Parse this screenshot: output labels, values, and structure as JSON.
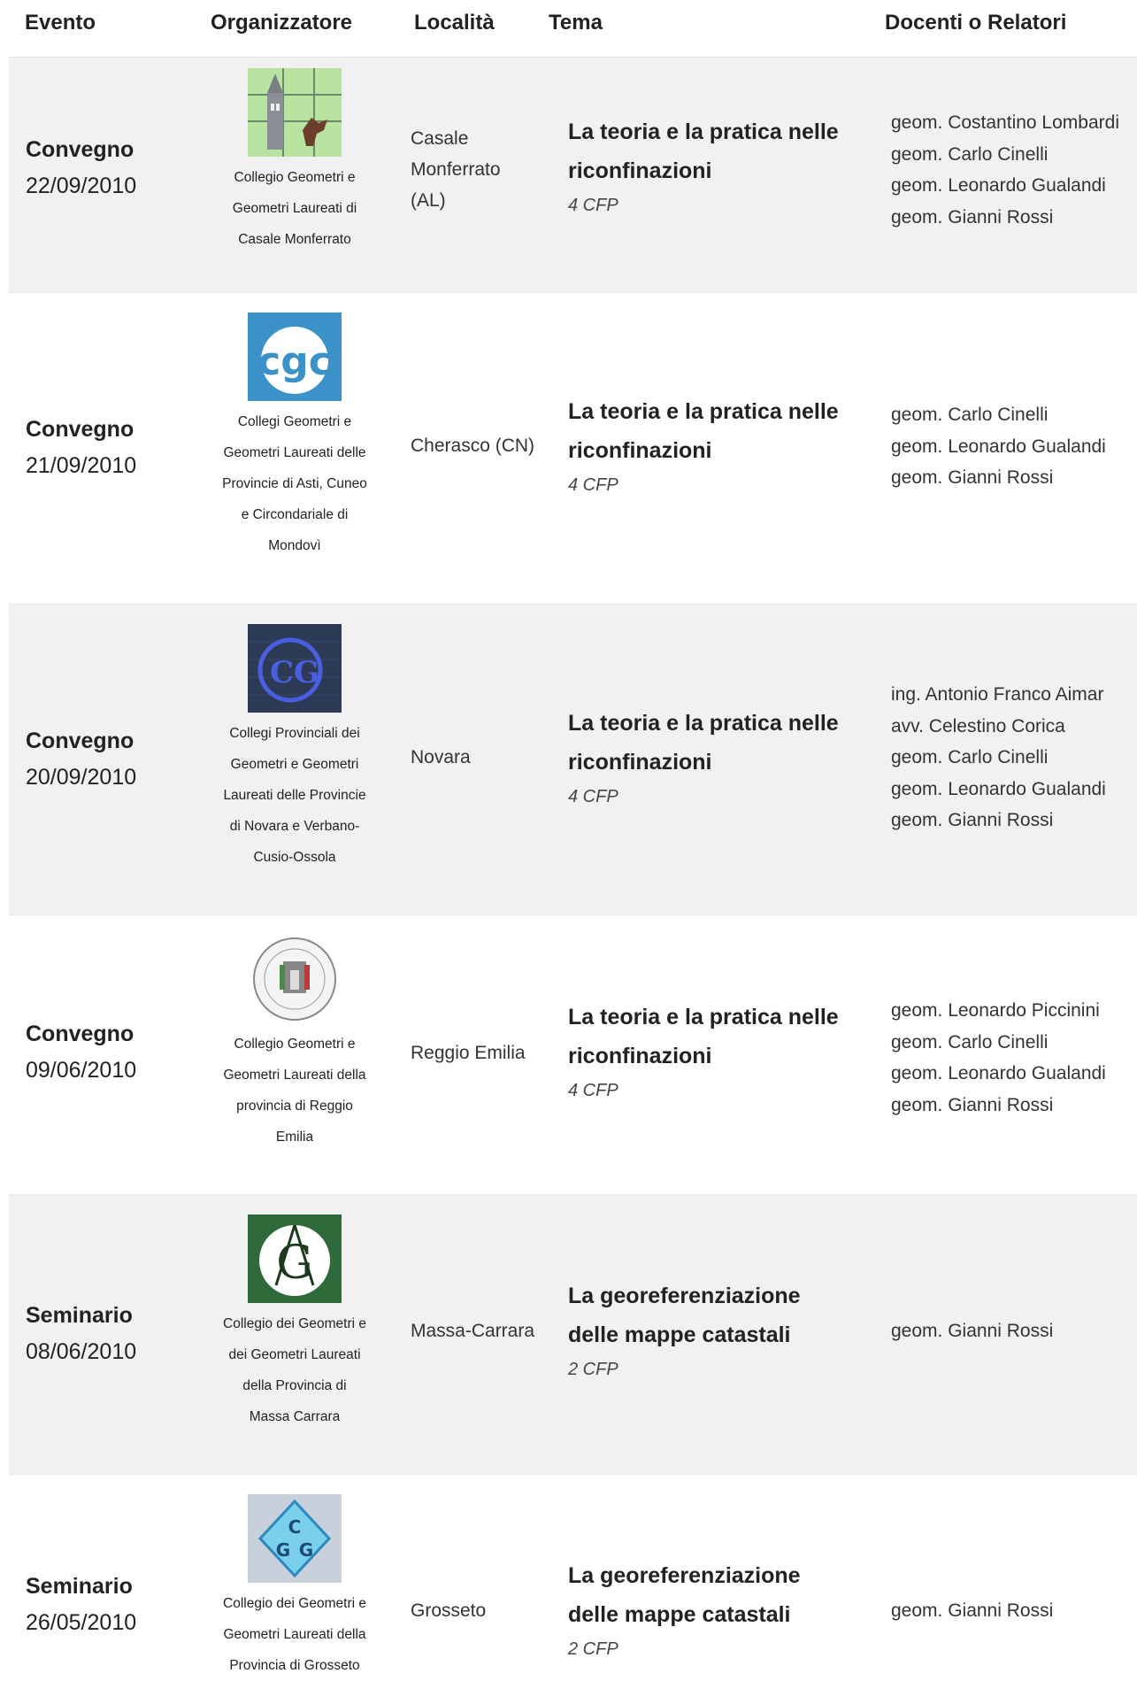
{
  "headers": {
    "evento": "Evento",
    "organizzatore": "Organizzatore",
    "localita": "Località",
    "tema": "Tema",
    "docenti": "Docenti o Relatori"
  },
  "rows": [
    {
      "type": "Convegno",
      "date": "22/09/2010",
      "logo": "casale-tower-logo",
      "org": [
        "Collegio Geometri e",
        "Geometri Laureati di",
        "Casale Monferrato"
      ],
      "loc": [
        "Casale",
        "Monferrato",
        "(AL)"
      ],
      "tema": [
        "La teoria e la pratica nelle",
        "riconfinazioni"
      ],
      "cfp": "4 CFP",
      "speakers": [
        "geom. Costantino Lombardi",
        "geom. Carlo Cinelli",
        "geom. Leonardo Gualandi",
        "geom. Gianni Rossi"
      ]
    },
    {
      "type": "Convegno",
      "date": "21/09/2010",
      "logo": "cgc-blue-logo",
      "org": [
        "Collegi Geometri e",
        "Geometri Laureati delle",
        "Provincie di Asti, Cuneo",
        "e Circondariale di",
        "Mondovì"
      ],
      "loc": [
        "Cherasco (CN)"
      ],
      "tema": [
        "La teoria e la pratica nelle",
        "riconfinazioni"
      ],
      "cfp": "4 CFP",
      "speakers": [
        "geom. Carlo Cinelli",
        "geom. Leonardo Gualandi",
        "geom. Gianni Rossi"
      ]
    },
    {
      "type": "Convegno",
      "date": "20/09/2010",
      "logo": "cg-novara-logo",
      "org": [
        "Collegi Provinciali dei",
        "Geometri e Geometri",
        "Laureati delle Provincie",
        "di Novara e Verbano-",
        "Cusio-Ossola"
      ],
      "loc": [
        "Novara"
      ],
      "tema": [
        "La teoria e la pratica nelle",
        "riconfinazioni"
      ],
      "cfp": "4 CFP",
      "speakers": [
        "ing. Antonio Franco Aimar",
        "avv. Celestino Corica",
        "geom. Carlo Cinelli",
        "geom. Leonardo Gualandi",
        "geom. Gianni Rossi"
      ]
    },
    {
      "type": "Convegno",
      "date": "09/06/2010",
      "logo": "reggio-seal-logo",
      "org": [
        "Collegio Geometri e",
        "Geometri Laureati della",
        "provincia di Reggio",
        "Emilia"
      ],
      "loc": [
        "Reggio Emilia"
      ],
      "tema": [
        "La teoria e la pratica nelle",
        "riconfinazioni"
      ],
      "cfp": "4 CFP",
      "speakers": [
        "geom. Leonardo Piccinini",
        "geom. Carlo Cinelli",
        "geom. Leonardo Gualandi",
        "geom. Gianni Rossi"
      ]
    },
    {
      "type": "Seminario",
      "date": "08/06/2010",
      "logo": "massa-compass-logo",
      "org": [
        "Collegio dei Geometri e",
        "dei Geometri Laureati",
        "della Provincia di",
        "Massa Carrara"
      ],
      "loc": [
        "Massa-Carrara"
      ],
      "tema": [
        "La georeferenziazione",
        "delle mappe catastali"
      ],
      "cfp": "2 CFP",
      "speakers": [
        "geom. Gianni Rossi"
      ]
    },
    {
      "type": "Seminario",
      "date": "26/05/2010",
      "logo": "grosseto-cgg-logo",
      "org": [
        "Collegio dei Geometri e",
        "Geometri Laureati della",
        "Provincia di Grosseto"
      ],
      "loc": [
        "Grosseto"
      ],
      "tema": [
        "La georeferenziazione",
        "delle mappe catastali"
      ],
      "cfp": "2 CFP",
      "speakers": [
        "geom. Gianni Rossi"
      ]
    }
  ]
}
